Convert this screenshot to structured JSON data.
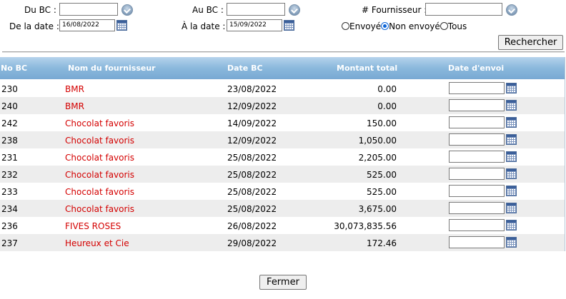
{
  "filters": {
    "du_bc_label": "Du BC :",
    "du_bc_value": "",
    "au_bc_label": "Au BC :",
    "au_bc_value": "",
    "fournisseur_label": "# Fournisseur :",
    "fournisseur_value": "",
    "de_la_date_label": "De la date :",
    "de_la_date_value": "16/08/2022",
    "a_la_date_label": "À la date :",
    "a_la_date_value": "15/09/2022",
    "radios": [
      {
        "label": "Envoyé",
        "checked": false
      },
      {
        "label": "Non envoyé",
        "checked": true
      },
      {
        "label": "Tous",
        "checked": false
      }
    ],
    "search_button": "Rechercher"
  },
  "table": {
    "headers": [
      "No BC",
      "Nom du fournisseur",
      "Date BC",
      "Montant total",
      "Date d'envoi"
    ],
    "rows": [
      {
        "no": "230",
        "name": "BMR",
        "date": "23/08/2022",
        "amount": "0.00",
        "send_date": ""
      },
      {
        "no": "240",
        "name": "BMR",
        "date": "12/09/2022",
        "amount": "0.00",
        "send_date": ""
      },
      {
        "no": "242",
        "name": "Chocolat favoris",
        "date": "14/09/2022",
        "amount": "150.00",
        "send_date": ""
      },
      {
        "no": "238",
        "name": "Chocolat favoris",
        "date": "12/09/2022",
        "amount": "1,050.00",
        "send_date": ""
      },
      {
        "no": "231",
        "name": "Chocolat favoris",
        "date": "25/08/2022",
        "amount": "2,205.00",
        "send_date": ""
      },
      {
        "no": "232",
        "name": "Chocolat favoris",
        "date": "25/08/2022",
        "amount": "525.00",
        "send_date": ""
      },
      {
        "no": "233",
        "name": "Chocolat favoris",
        "date": "25/08/2022",
        "amount": "525.00",
        "send_date": ""
      },
      {
        "no": "234",
        "name": "Chocolat favoris",
        "date": "25/08/2022",
        "amount": "3,675.00",
        "send_date": ""
      },
      {
        "no": "236",
        "name": "FIVES ROSES",
        "date": "26/08/2022",
        "amount": "30,073,835.56",
        "send_date": ""
      },
      {
        "no": "237",
        "name": "Heureux et Cie",
        "date": "29/08/2022",
        "amount": "172.46",
        "send_date": ""
      }
    ]
  },
  "footer": {
    "close_button": "Fermer"
  },
  "colors": {
    "header_gradient_top": "#b5d3ec",
    "header_gradient_bottom": "#78a9d3",
    "supplier_name": "#d40000",
    "alt_row": "#ededed"
  }
}
